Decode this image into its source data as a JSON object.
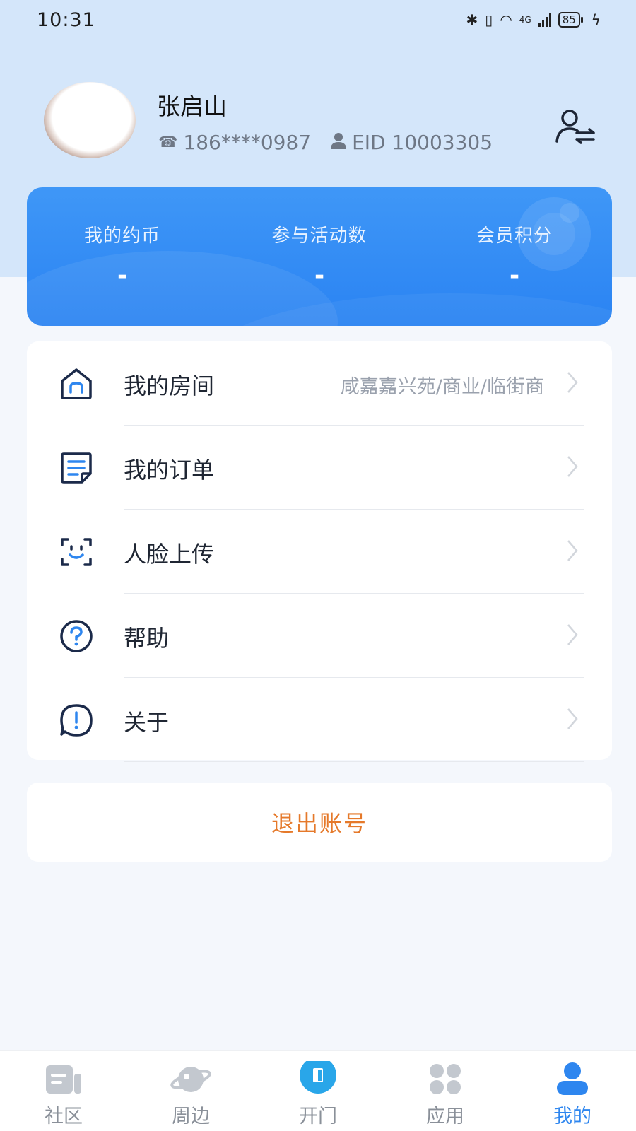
{
  "status_bar": {
    "time": "10:31",
    "network": "4G",
    "battery": "85"
  },
  "profile": {
    "name": "张启山",
    "phone": "186****0987",
    "eid": "EID 10003305",
    "icons": {
      "phone": "phone-icon",
      "user": "user-icon",
      "switch": "switch-account-icon"
    }
  },
  "stats": {
    "coins_label": "我的约币",
    "coins_value": "-",
    "activities_label": "参与活动数",
    "activities_value": "-",
    "points_label": "会员积分",
    "points_value": "-"
  },
  "menu": {
    "items": [
      {
        "label": "我的房间",
        "value": "咸嘉嘉兴苑/商业/临街商",
        "icon": "home-icon"
      },
      {
        "label": "我的订单",
        "value": "",
        "icon": "order-icon"
      },
      {
        "label": "人脸上传",
        "value": "",
        "icon": "face-scan-icon"
      },
      {
        "label": "帮助",
        "value": "",
        "icon": "help-icon"
      },
      {
        "label": "关于",
        "value": "",
        "icon": "about-icon"
      }
    ]
  },
  "logout_label": "退出账号",
  "tabs": [
    {
      "label": "社区",
      "icon": "community-icon",
      "active": false
    },
    {
      "label": "周边",
      "icon": "nearby-icon",
      "active": false
    },
    {
      "label": "开门",
      "icon": "door-open-icon",
      "active": false
    },
    {
      "label": "应用",
      "icon": "apps-icon",
      "active": false
    },
    {
      "label": "我的",
      "icon": "profile-icon",
      "active": true
    }
  ],
  "colors": {
    "accent": "#2e86ef",
    "card_blue": "#3590f5",
    "logout": "#e5792a",
    "header_bg": "#d4e6fa"
  }
}
